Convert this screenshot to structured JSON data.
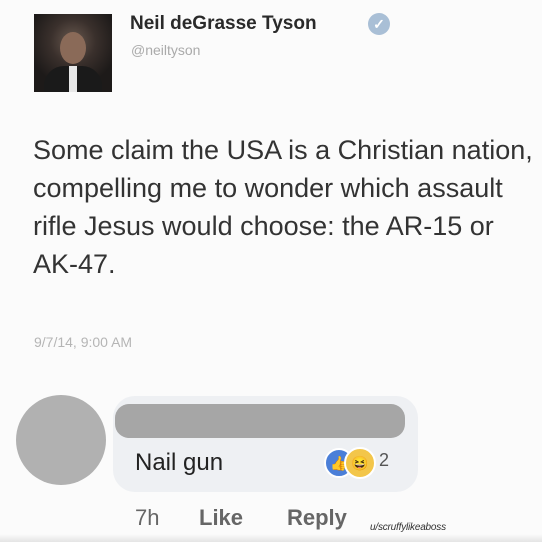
{
  "tweet": {
    "display_name": "Neil deGrasse Tyson",
    "handle": "@neiltyson",
    "verified_icon": "verified-check-icon",
    "text": "Some claim the USA is a Christian nation, compelling me to wonder which assault rifle Jesus would choose: the AR-15 or AK-47.",
    "timestamp": "9/7/14, 9:00 AM"
  },
  "comment": {
    "text": "Nail gun",
    "reaction_count": "2",
    "reaction_icons": [
      "like-reaction-icon",
      "haha-reaction-icon"
    ],
    "time": "7h",
    "like_label": "Like",
    "reply_label": "Reply"
  },
  "watermark": "u/scruffylikeaboss",
  "colors": {
    "background": "#fbfbfb",
    "bubble": "#eef0f3",
    "redaction": "#a6a6a6",
    "like_blue": "#4b7fd8",
    "haha_yellow": "#f3c64a"
  }
}
